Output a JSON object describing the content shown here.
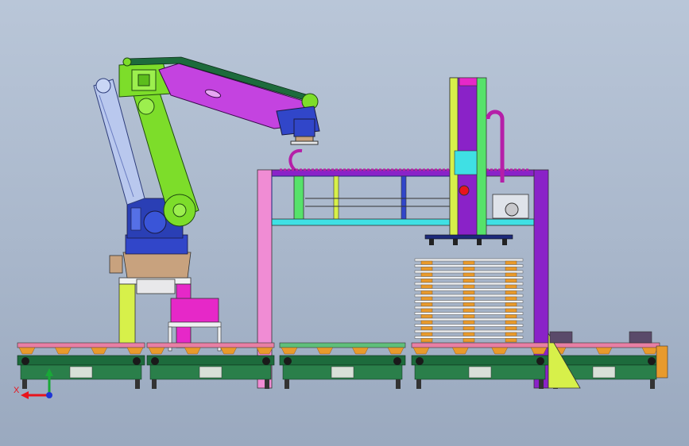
{
  "axes": {
    "x_label": "X",
    "x_color": "#e8141c",
    "y_color": "#19a838",
    "z_color": "#1e35d6"
  },
  "colors": {
    "robot_green": "#7ddd2a",
    "robot_magenta": "#c443e0",
    "robot_blue": "#3146c9",
    "robot_pale": "#b9c8ee",
    "base_tan": "#c8a27e",
    "frame_pink": "#f08cd4",
    "frame_purple": "#8a22c8",
    "frame_yellow": "#d7f04a",
    "conveyor_green": "#1d6b3c",
    "conveyor_rail": "#e87fa4",
    "roller_orange": "#e89a2c",
    "stand_magenta": "#e628c8",
    "cyan": "#3fe0e4"
  },
  "components": [
    {
      "name": "palletizing-robot",
      "icon": "robot-arm-icon"
    },
    {
      "name": "gantry-frame",
      "icon": "gantry-icon"
    },
    {
      "name": "pallet-stack",
      "icon": "pallet-stack-icon"
    },
    {
      "name": "roller-conveyors",
      "icon": "conveyor-icon"
    },
    {
      "name": "pallet-dispenser",
      "icon": "dispenser-icon"
    }
  ],
  "pallet_stack": {
    "count": 14
  }
}
